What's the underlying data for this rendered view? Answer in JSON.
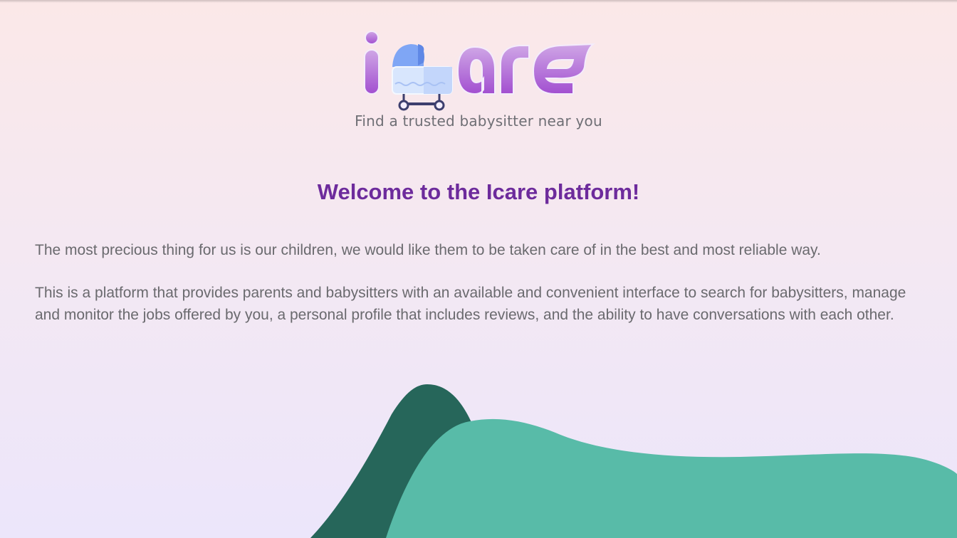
{
  "brand": {
    "logo_text": "icare",
    "tagline": "Find a trusted babysitter near you",
    "logo_icon": "baby-stroller-icon",
    "logo_color": "#b36bd8"
  },
  "main": {
    "heading": "Welcome to the Icare platform!",
    "paragraphs": [
      "The most precious thing for us is our children, we would like them to be taken care of in the best and most reliable way.",
      "This is a platform that provides parents and babysitters with an available and convenient interface to search for babysitters, manage and monitor the jobs offered by you, a personal profile that includes reviews, and the ability to have conversations with each other."
    ]
  },
  "colors": {
    "heading": "#6d2b9c",
    "body_text": "#6a6a6e",
    "hill_dark": "#26665a",
    "hill_light": "#58bba8"
  }
}
